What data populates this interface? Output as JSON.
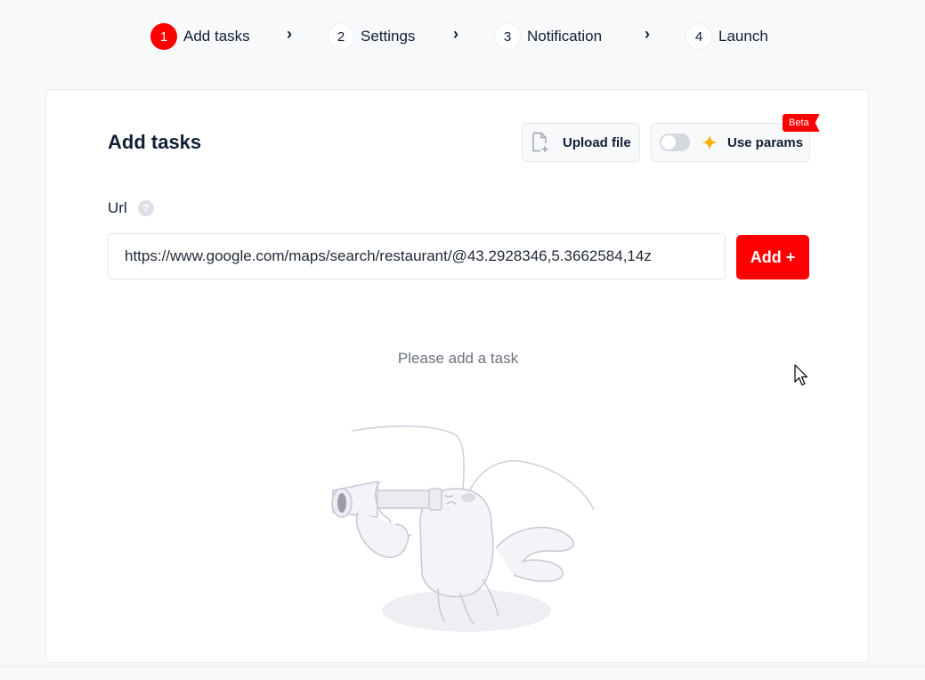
{
  "stepper": {
    "steps": [
      {
        "num": "1",
        "label": "Add tasks"
      },
      {
        "num": "2",
        "label": "Settings"
      },
      {
        "num": "3",
        "label": "Notification"
      },
      {
        "num": "4",
        "label": "Launch"
      }
    ],
    "chevron": "›",
    "active_color": "#ff0000"
  },
  "card": {
    "title": "Add tasks",
    "upload_label": "Upload file",
    "params_label": "Use params",
    "beta_label": "Beta",
    "url_label": "Url",
    "help_icon_glyph": "?",
    "url_value": "https://www.google.com/maps/search/restaurant/@43.2928346,5.3662584,14z",
    "add_label": "Add +",
    "empty_message": "Please add a task"
  },
  "colors": {
    "accent": "#ff0000",
    "sparkle": "#f5b301"
  },
  "icons": [
    "file-plus-icon",
    "sparkle-icon",
    "help-icon",
    "lobster-telescope-illustration",
    "mouse-cursor-icon"
  ]
}
